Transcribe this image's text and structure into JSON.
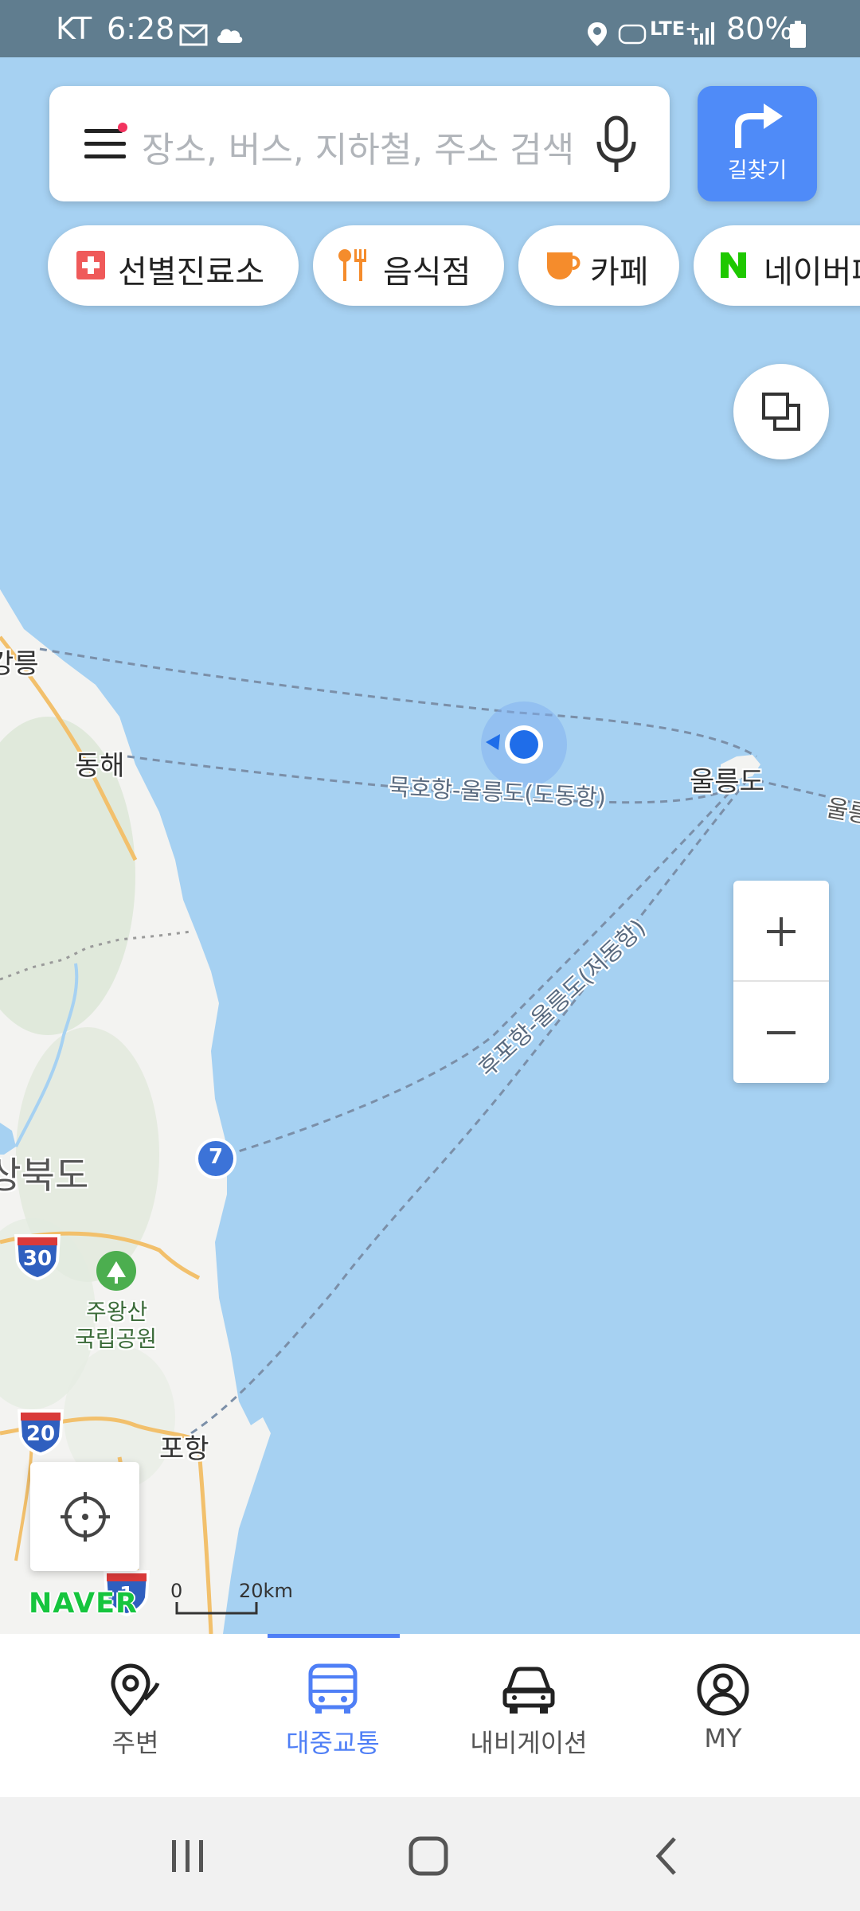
{
  "status_bar": {
    "carrier": "KT",
    "time": "6:28",
    "battery": "80%",
    "network": "LTE+"
  },
  "search": {
    "placeholder": "장소, 버스, 지하철, 주소 검색",
    "route_button_label": "길찾기"
  },
  "chips": [
    {
      "label": "선별진료소",
      "icon": "medical-cross-icon"
    },
    {
      "label": "음식점",
      "icon": "fork-knife-icon"
    },
    {
      "label": "카페",
      "icon": "coffee-cup-icon"
    },
    {
      "label": "네이버페",
      "icon": "naver-n-icon"
    }
  ],
  "map": {
    "place_labels": {
      "gangneung": "강릉",
      "donghae": "동해",
      "ulleungdo": "울릉도",
      "ulleung_edge": "울릉",
      "gyeongbuk": "경상북도",
      "pohang": "포항",
      "juwangsan_line1": "주왕산",
      "juwangsan_line2": "국립공원"
    },
    "route_labels": {
      "mukho": "묵호항-울릉도(도동항)",
      "hupo": "후포항-울릉도(저동항)"
    },
    "road_shields": {
      "route7": "7",
      "i30": "30",
      "i20": "20",
      "i1": "1"
    },
    "scale": {
      "zero": "0",
      "distance": "20km"
    },
    "attribution": "NAVER"
  },
  "bottom_nav": {
    "items": [
      {
        "label": "주변",
        "icon": "nearby-pin-icon",
        "active": false
      },
      {
        "label": "대중교통",
        "icon": "bus-icon",
        "active": true
      },
      {
        "label": "내비게이션",
        "icon": "car-icon",
        "active": false
      },
      {
        "label": "MY",
        "icon": "profile-icon",
        "active": false
      }
    ]
  },
  "colors": {
    "sea": "#a6d1f2",
    "land": "#f3f3f1",
    "status_bar": "#607d8f",
    "accent_blue": "#4f8bf8",
    "active_nav": "#4f7ff6",
    "route_line": "#7b8fa8",
    "naver_green": "#16c53e"
  }
}
